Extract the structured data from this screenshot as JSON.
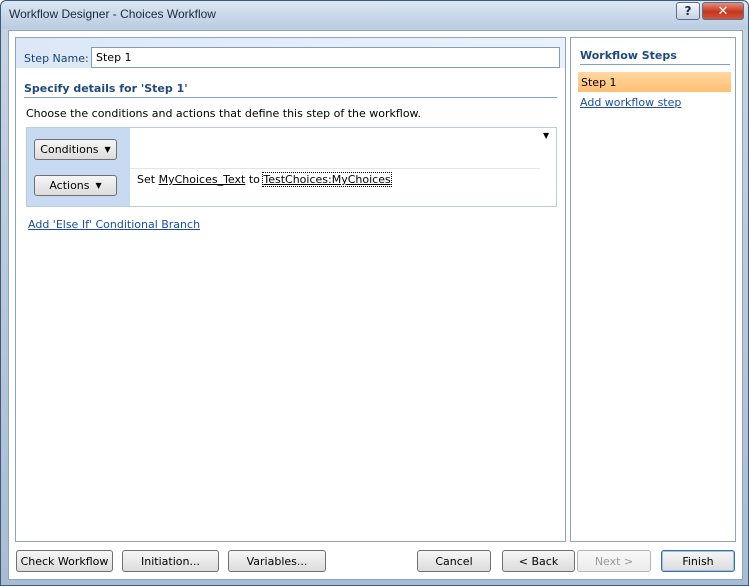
{
  "window": {
    "title": "Workflow Designer - Choices Workflow",
    "help_label": "?",
    "close_label": "✕"
  },
  "step": {
    "name_label": "Step Name:",
    "name_value": "Step 1",
    "specify_header": "Specify details for 'Step 1'",
    "instructions": "Choose the conditions and actions that define this step of the workflow."
  },
  "branch": {
    "conditions_label": "Conditions",
    "actions_label": "Actions",
    "dropdown_caret": "▼",
    "action": {
      "prefix": "Set",
      "variable": "MyChoices_Text",
      "middle": "to",
      "value": "TestChoices:MyChoices"
    }
  },
  "else_if_link": "Add 'Else If' Conditional Branch",
  "workflow_steps": {
    "header": "Workflow Steps",
    "items": [
      {
        "label": "Step 1",
        "selected": true
      }
    ],
    "add_link": "Add workflow step"
  },
  "footer": {
    "check_workflow": "Check Workflow",
    "initiation": "Initiation...",
    "variables": "Variables...",
    "cancel": "Cancel",
    "back": "< Back",
    "next": "Next >",
    "finish": "Finish"
  }
}
